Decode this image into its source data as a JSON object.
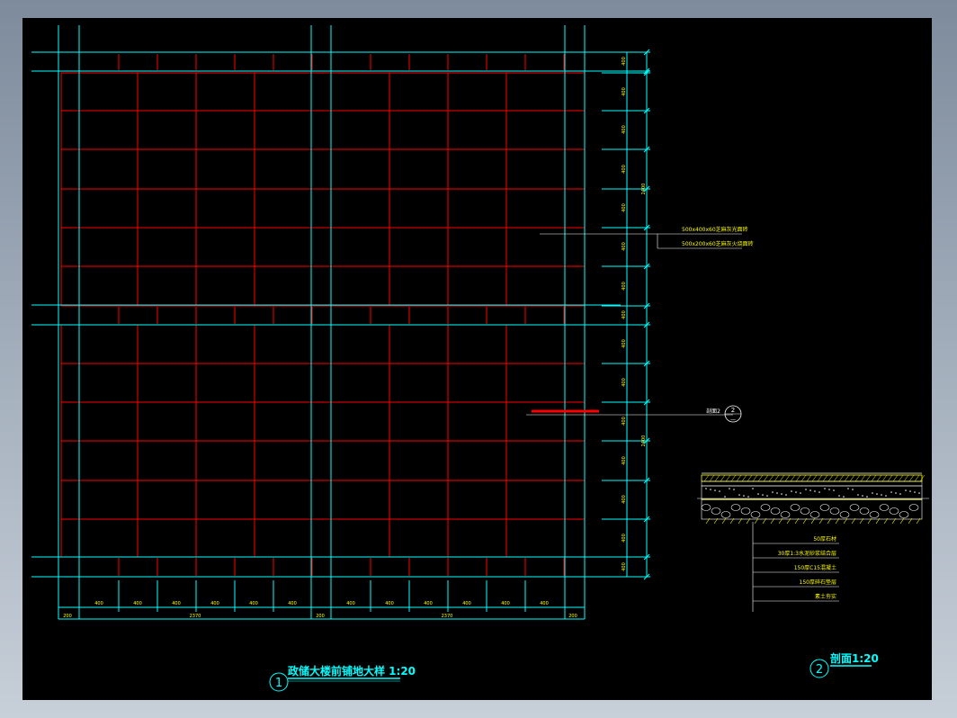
{
  "colors": {
    "background": "#000000",
    "cyan": "#00ffff",
    "red": "#ff0000",
    "yellow": "#ffff00",
    "white": "#ffffff",
    "frame": "#8e9aa9"
  },
  "plan": {
    "title": "政储大楼前铺地大样 1:20",
    "number": "1",
    "dim_bottom_small": "400",
    "dim_bottom_edge": "200",
    "dim_bottom_span": "2370",
    "dim_right_small": "400",
    "dim_right_strip": "400",
    "dim_right_span": "2400",
    "callout_upper_1": "500x400x60芝麻灰光面砖",
    "callout_upper_2": "500x200x60芝麻灰火烧面砖",
    "section_mark_label": "剖面2",
    "section_mark_top": "2",
    "section_mark_bottom": "—"
  },
  "section": {
    "title": "剖面1:20",
    "number": "2",
    "layers": [
      "50厚石材",
      "30厚1:3水泥砂浆结合层",
      "150厚C15混凝土",
      "150厚碎石垫层",
      "素土夯实"
    ]
  }
}
